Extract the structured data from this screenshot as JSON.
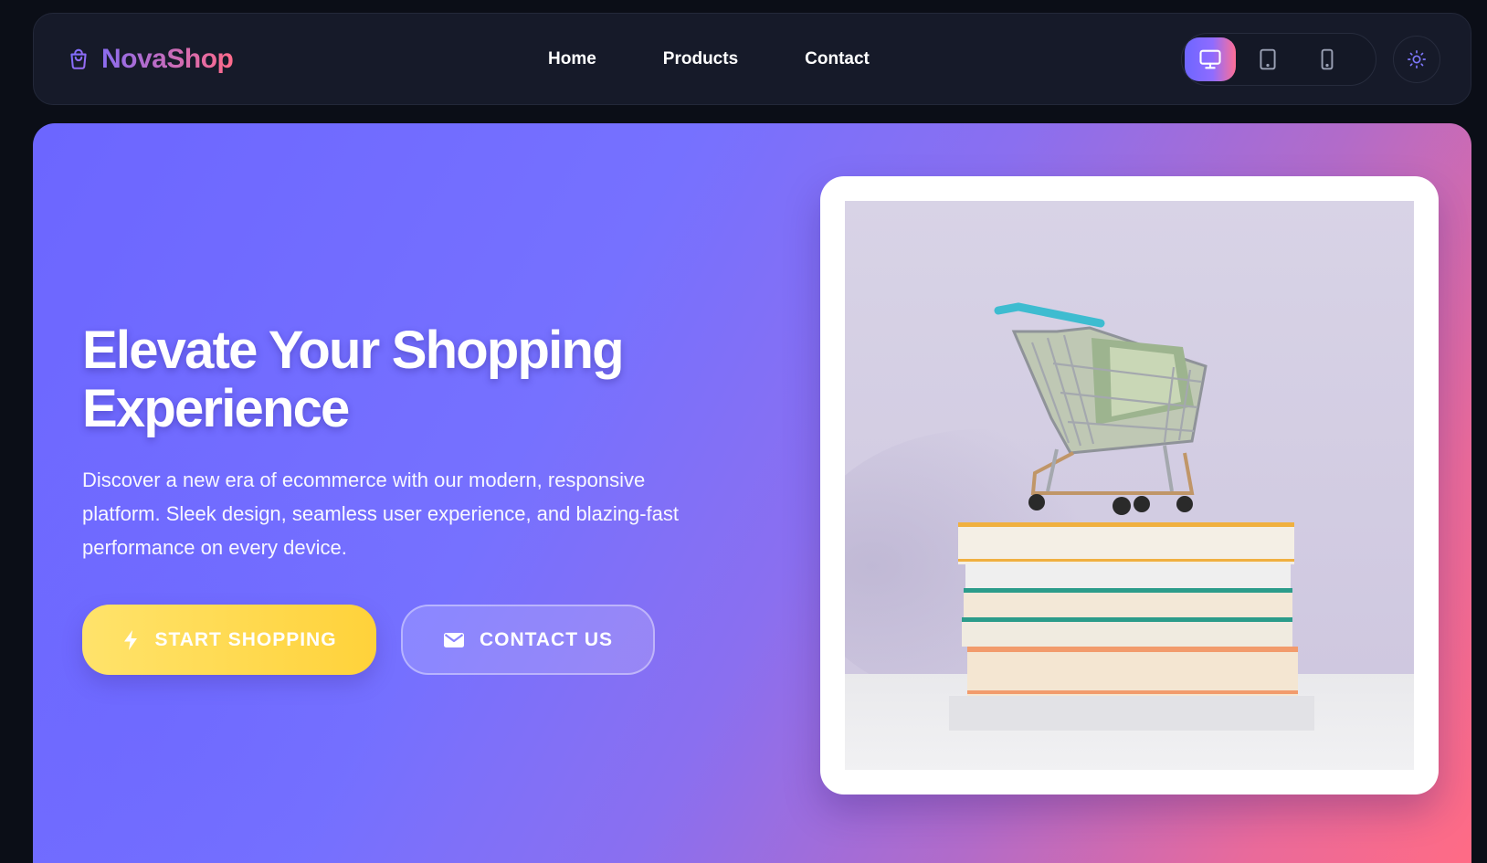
{
  "header": {
    "brand": {
      "name": "NovaShop",
      "icon": "shopping-bag-icon"
    },
    "nav": [
      {
        "label": "Home"
      },
      {
        "label": "Products"
      },
      {
        "label": "Contact"
      }
    ],
    "device_toggle": {
      "options": [
        {
          "icon": "desktop-icon",
          "active": true
        },
        {
          "icon": "tablet-icon",
          "active": false
        },
        {
          "icon": "mobile-icon",
          "active": false
        }
      ]
    },
    "theme_toggle": {
      "icon": "sun-icon"
    }
  },
  "hero": {
    "title_line1": "Elevate Your Shopping",
    "title_line2": "Experience",
    "description": "Discover a new era of ecommerce with our modern, responsive platform. Sleek design, seamless user experience, and blazing-fast performance on every device.",
    "primary_button": {
      "label": "START SHOPPING",
      "icon": "bolt-icon"
    },
    "secondary_button": {
      "label": "CONTACT US",
      "icon": "envelope-icon"
    },
    "image": {
      "subject": "shopping-cart-with-cash-on-book-stack"
    }
  },
  "colors": {
    "page_bg": "#0b0e17",
    "nav_bg": "#161a29",
    "accent_purple": "#6e66ff",
    "accent_pink": "#ff6b85",
    "cta_yellow": "#ffd23a"
  }
}
